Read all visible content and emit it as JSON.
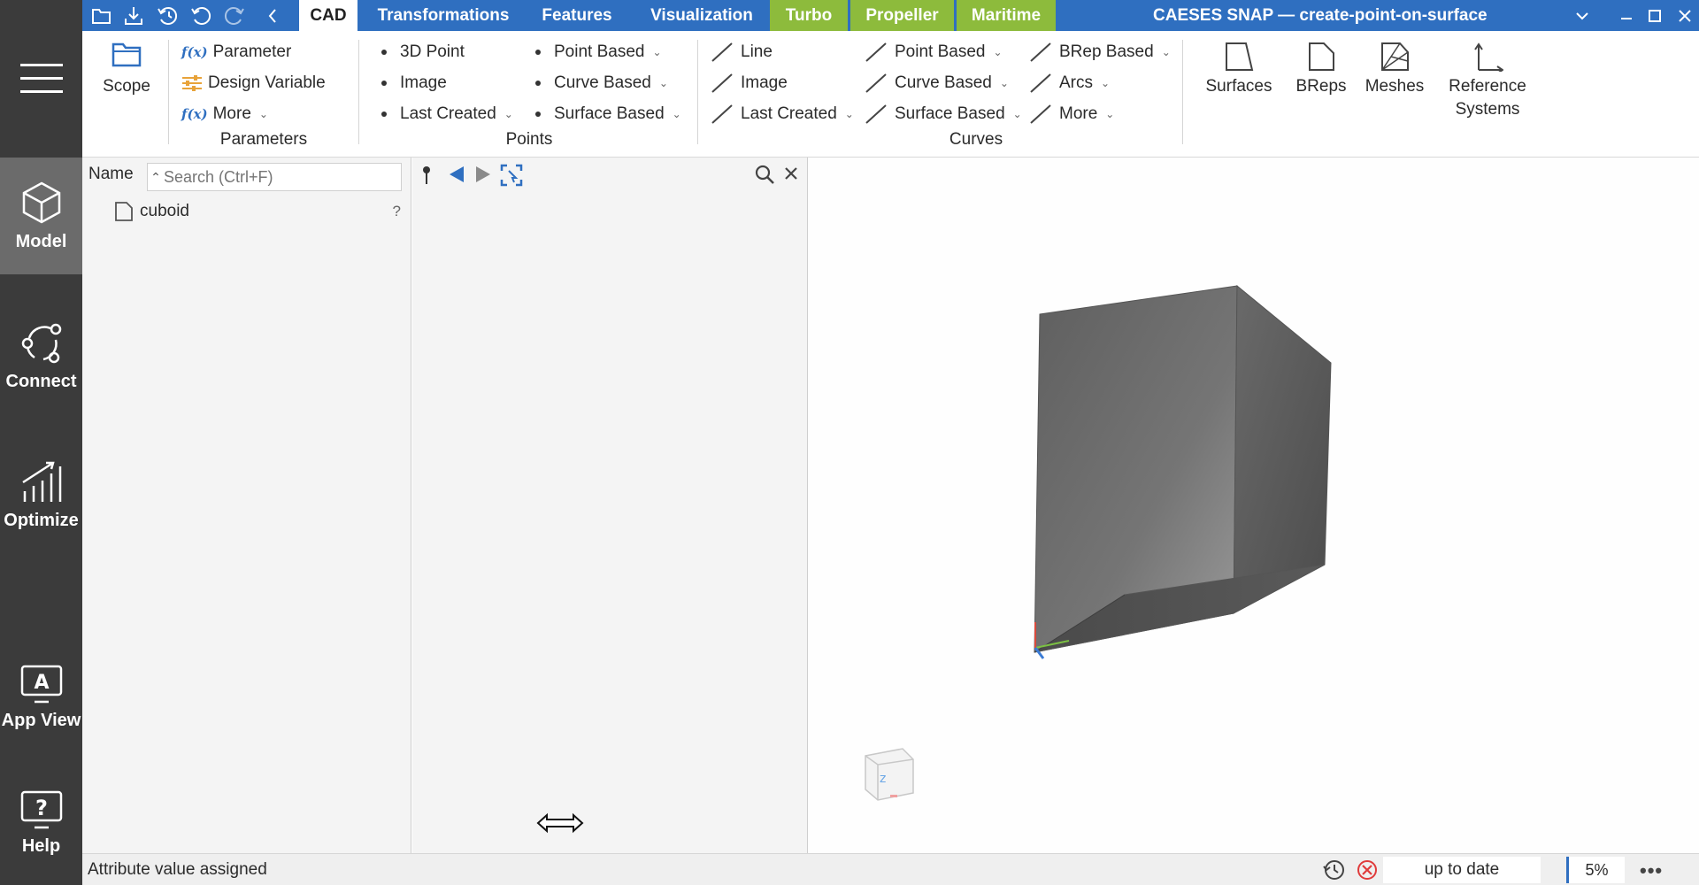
{
  "window": {
    "title": "CAESES SNAP  —  create-point-on-surface"
  },
  "quick_access": {
    "icons": [
      "open-folder-icon",
      "save-icon",
      "history-undo-icon",
      "undo-icon",
      "redo-icon",
      "back-chevron-icon"
    ]
  },
  "tabs": [
    {
      "label": "CAD",
      "active": true
    },
    {
      "label": "Transformations"
    },
    {
      "label": "Features"
    },
    {
      "label": "Visualization"
    },
    {
      "label": "Turbo",
      "green": true
    },
    {
      "label": "Propeller",
      "green": true
    },
    {
      "label": "Maritime",
      "green": true
    }
  ],
  "sidebar": {
    "items": [
      {
        "label": "Model",
        "icon": "cube-icon",
        "active": true
      },
      {
        "label": "Connect",
        "icon": "connect-icon"
      },
      {
        "label": "Optimize",
        "icon": "chart-icon"
      },
      {
        "label": "App View",
        "icon": "app-view-icon"
      },
      {
        "label": "Help",
        "icon": "help-icon"
      }
    ]
  },
  "ribbon": {
    "scope": {
      "label": "Scope"
    },
    "parameters": {
      "items": [
        "Parameter",
        "Design Variable",
        "More"
      ],
      "group_label": "Parameters"
    },
    "points": {
      "col1": [
        "3D Point",
        "Image",
        "Last Created"
      ],
      "col2": [
        "Point Based",
        "Curve Based",
        "Surface Based"
      ],
      "group_label": "Points"
    },
    "curves": {
      "col1": [
        "Line",
        "Image",
        "Last Created"
      ],
      "col2": [
        "Point Based",
        "Curve Based",
        "Surface Based"
      ],
      "col3": [
        "BRep Based",
        "Arcs",
        "More"
      ],
      "group_label": "Curves"
    },
    "big_buttons": [
      {
        "label": "Surfaces",
        "icon": "surface-icon"
      },
      {
        "label": "BReps",
        "icon": "brep-icon"
      },
      {
        "label": "Meshes",
        "icon": "mesh-icon"
      },
      {
        "label": "Reference\nSystems",
        "label_line1": "Reference",
        "label_line2": "Systems",
        "icon": "reference-systems-icon"
      }
    ]
  },
  "tree": {
    "name_label": "Name",
    "search_placeholder": "Search (Ctrl+F)",
    "items": [
      {
        "label": "cuboid",
        "icon": "file-icon",
        "status": "?"
      }
    ]
  },
  "statusbar": {
    "message": "Attribute value assigned",
    "update_status": "up to date",
    "progress": "5%"
  },
  "colors": {
    "title_bar": "#2f6fc0",
    "green_tab": "#8dbb3c",
    "sidebar": "#3b3b3b",
    "sidebar_active": "#6b6b6b"
  }
}
